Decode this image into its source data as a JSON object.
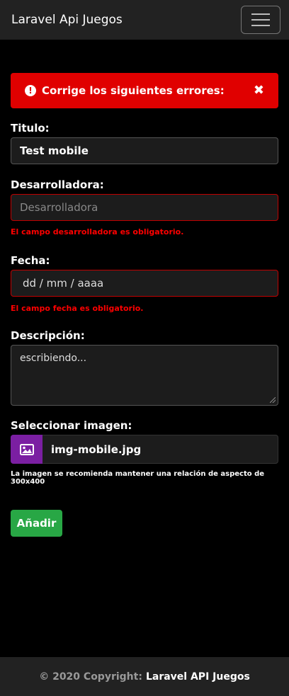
{
  "navbar": {
    "brand": "Laravel Api Juegos"
  },
  "alert": {
    "message": "Corrige los siguientes errores:"
  },
  "form": {
    "titulo": {
      "label": "Titulo:",
      "value": "Test mobile"
    },
    "desarrolladora": {
      "label": "Desarrolladora:",
      "placeholder": "Desarrolladora",
      "error": "El campo desarrolladora es obligatorio."
    },
    "fecha": {
      "label": "Fecha:",
      "placeholder": "dd / mm / aaaa",
      "error": "El campo fecha es obligatorio."
    },
    "descripcion": {
      "label": "Descripción:",
      "value": "escribiendo..."
    },
    "imagen": {
      "label": "Seleccionar imagen:",
      "file_name": "img-mobile.jpg",
      "hint": "La imagen se recomienda mantener una relación de aspecto de 300x400"
    },
    "submit_label": "Añadir"
  },
  "footer": {
    "copyright": "© 2020 Copyright:",
    "app_name": "Laravel API Juegos"
  },
  "colors": {
    "alert": "#e00000",
    "error_text": "#ff0000",
    "submit": "#28a745",
    "file_button": "#7b1fa2"
  }
}
